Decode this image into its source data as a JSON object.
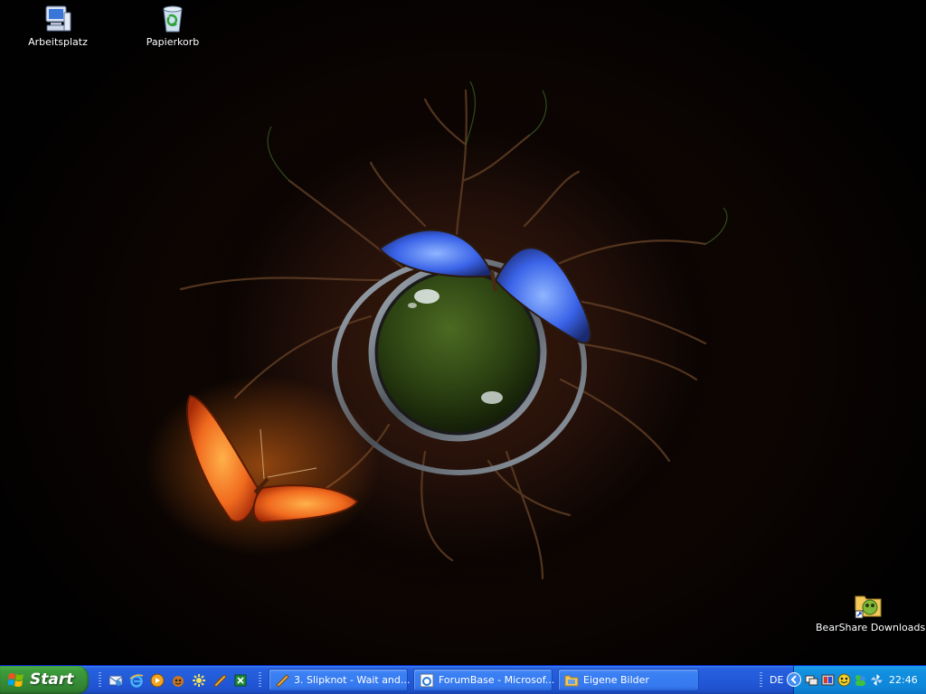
{
  "desktop": {
    "icons": [
      {
        "label": "Arbeitsplatz",
        "icon": "my-computer-icon"
      },
      {
        "label": "Papierkorb",
        "icon": "recycle-bin-icon"
      },
      {
        "label": "BearShare Downloads",
        "icon": "folder-shortcut-icon"
      }
    ]
  },
  "taskbar": {
    "start_label": "Start",
    "quick_launch": [
      "outlook-express-icon",
      "internet-explorer-icon",
      "media-player-icon",
      "app-icon",
      "settings-icon",
      "winamp-icon",
      "app-icon-2"
    ],
    "tasks": [
      {
        "label": "3. Slipknot - Wait and...",
        "icon": "winamp-icon"
      },
      {
        "label": "ForumBase - Microsof...",
        "icon": "internet-explorer-icon"
      },
      {
        "label": "Eigene Bilder",
        "icon": "folder-icon"
      }
    ],
    "tray": {
      "language": "DE",
      "icons": [
        "chevron-left-icon",
        "network-icon",
        "volume-icon",
        "bearshare-icon",
        "messenger-icon",
        "pinwheel-icon"
      ],
      "clock": "22:46"
    }
  },
  "colors": {
    "taskbar_blue": "#245edb",
    "start_green": "#388e38",
    "tray_blue": "#0e85d8"
  }
}
